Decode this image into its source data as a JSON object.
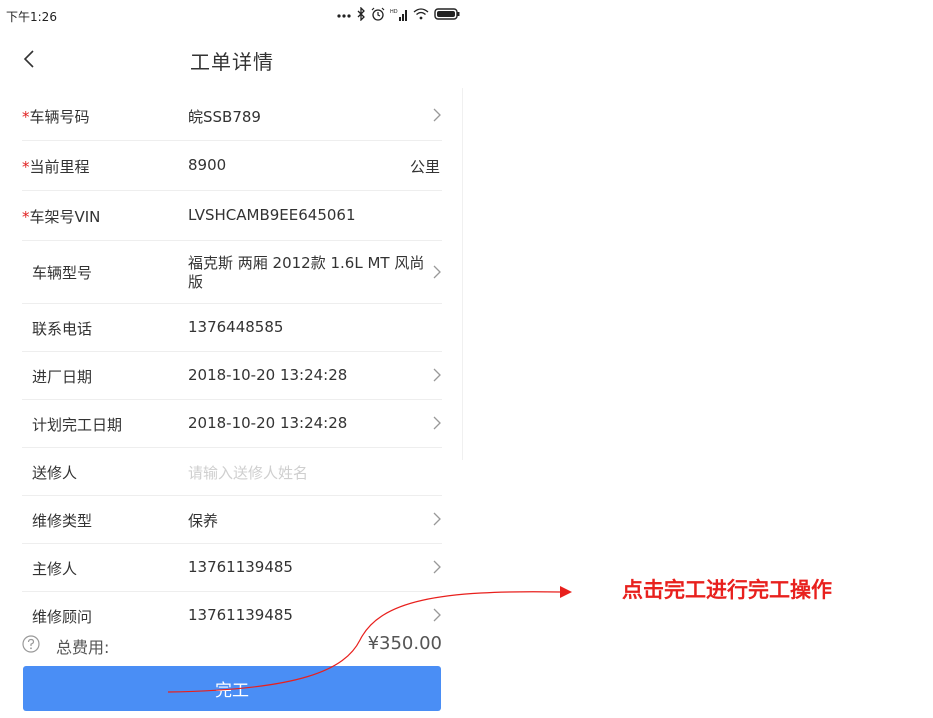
{
  "status_bar": {
    "time": "下午1:26",
    "icons": [
      "more-dots-icon",
      "bluetooth-icon",
      "alarm-icon",
      "signal-icon",
      "wifi-icon",
      "battery-icon"
    ]
  },
  "nav": {
    "title": "工单详情",
    "back_icon": "chevron-left-icon"
  },
  "form": {
    "rows": [
      {
        "label": "车辆号码",
        "required": true,
        "value": "皖SSB789",
        "chevron": true
      },
      {
        "label": "当前里程",
        "required": true,
        "value": "8900",
        "unit": "公里"
      },
      {
        "label": "车架号VIN",
        "required": true,
        "value": "LVSHCAMB9EE645061"
      },
      {
        "label": "车辆型号",
        "required": false,
        "value": "福克斯 两厢 2012款 1.6L MT 风尚版",
        "chevron": true
      },
      {
        "label": "联系电话",
        "required": false,
        "value": "1376448585"
      },
      {
        "label": "进厂日期",
        "required": false,
        "value": "2018-10-20 13:24:28",
        "chevron": true
      },
      {
        "label": "计划完工日期",
        "required": false,
        "value": "2018-10-20 13:24:28",
        "chevron": true
      },
      {
        "label": "送修人",
        "required": false,
        "placeholder": "请输入送修人姓名"
      },
      {
        "label": "维修类型",
        "required": false,
        "value": "保养",
        "chevron": true
      },
      {
        "label": "主修人",
        "required": false,
        "value": "13761139485",
        "chevron": true
      },
      {
        "label": "维修顾问",
        "required": false,
        "value": "13761139485",
        "chevron": true
      }
    ],
    "required_mark": "*"
  },
  "footer": {
    "total_label": "总费用:",
    "total_value": "¥350.00",
    "finish_button": "完工"
  },
  "annotation": {
    "text": "点击完工进行完工操作",
    "color": "#e8201d"
  },
  "colors": {
    "primary_button": "#4a8ef5",
    "required": "#e02020",
    "placeholder": "#cfcfcf"
  }
}
